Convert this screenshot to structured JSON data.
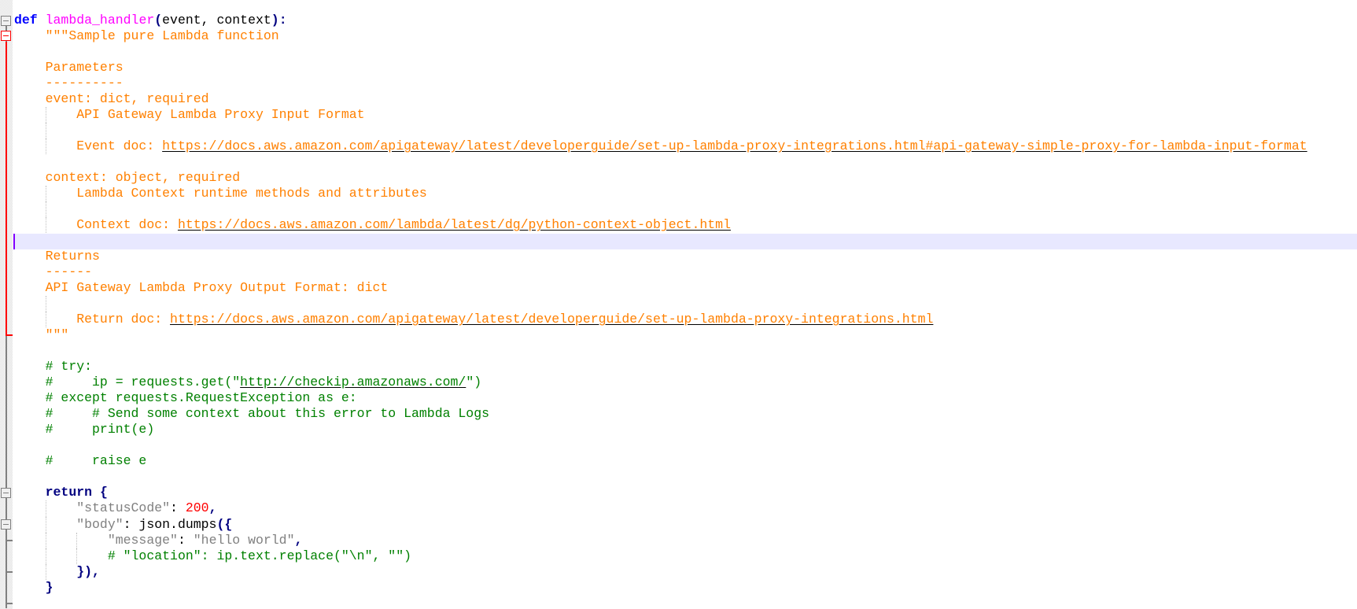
{
  "editor": {
    "language": "python",
    "current_line_index": 14,
    "colors": {
      "keyword": "#0000ff",
      "function_name": "#ff00ff",
      "docstring": "#ff8000",
      "comment": "#008000",
      "string": "#808080",
      "number": "#ff0000",
      "operator": "#000080",
      "current_line_bg": "#e8e8ff",
      "fold_marker_active": "#ff0000",
      "fold_marker": "#808080"
    },
    "lines": [
      {
        "tokens": [
          {
            "t": "def",
            "c": "kw"
          },
          {
            "t": " ",
            "c": ""
          },
          {
            "t": "lambda_handler",
            "c": "fn"
          },
          {
            "t": "(",
            "c": "op"
          },
          {
            "t": "event, context",
            "c": ""
          },
          {
            "t": ")",
            "c": "op"
          },
          {
            "t": ":",
            "c": "op"
          }
        ]
      },
      {
        "indent": 4,
        "tokens": [
          {
            "t": "\"\"\"Sample pure Lambda function",
            "c": "doc"
          }
        ]
      },
      {
        "indent": 4,
        "tokens": []
      },
      {
        "indent": 4,
        "tokens": [
          {
            "t": "Parameters",
            "c": "doc"
          }
        ]
      },
      {
        "indent": 4,
        "tokens": [
          {
            "t": "----------",
            "c": "doc"
          }
        ]
      },
      {
        "indent": 4,
        "tokens": [
          {
            "t": "event: dict, required",
            "c": "doc"
          }
        ]
      },
      {
        "indent": 8,
        "tokens": [
          {
            "t": "API Gateway Lambda Proxy Input Format",
            "c": "doc"
          }
        ]
      },
      {
        "indent": 8,
        "tokens": []
      },
      {
        "indent": 8,
        "tokens": [
          {
            "t": "Event doc: ",
            "c": "doc"
          },
          {
            "t": "https://docs.aws.amazon.com/apigateway/latest/developerguide/set-up-lambda-proxy-integrations.html#api-gateway-simple-proxy-for-lambda-input-format",
            "c": "doc link"
          }
        ]
      },
      {
        "indent": 4,
        "tokens": []
      },
      {
        "indent": 4,
        "tokens": [
          {
            "t": "context: object, required",
            "c": "doc"
          }
        ]
      },
      {
        "indent": 8,
        "tokens": [
          {
            "t": "Lambda Context runtime methods and attributes",
            "c": "doc"
          }
        ]
      },
      {
        "indent": 8,
        "tokens": []
      },
      {
        "indent": 8,
        "tokens": [
          {
            "t": "Context doc: ",
            "c": "doc"
          },
          {
            "t": "https://docs.aws.amazon.com/lambda/latest/dg/python-context-object.html",
            "c": "doc link"
          }
        ]
      },
      {
        "indent": 0,
        "tokens": []
      },
      {
        "indent": 4,
        "tokens": [
          {
            "t": "Returns",
            "c": "doc"
          }
        ]
      },
      {
        "indent": 4,
        "tokens": [
          {
            "t": "------",
            "c": "doc"
          }
        ]
      },
      {
        "indent": 4,
        "tokens": [
          {
            "t": "API Gateway Lambda Proxy Output Format: dict",
            "c": "doc"
          }
        ]
      },
      {
        "indent": 8,
        "tokens": []
      },
      {
        "indent": 8,
        "tokens": [
          {
            "t": "Return doc: ",
            "c": "doc"
          },
          {
            "t": "https://docs.aws.amazon.com/apigateway/latest/developerguide/set-up-lambda-proxy-integrations.html",
            "c": "doc link"
          }
        ]
      },
      {
        "indent": 4,
        "tokens": [
          {
            "t": "\"\"\"",
            "c": "doc"
          }
        ]
      },
      {
        "indent": 0,
        "tokens": []
      },
      {
        "indent": 4,
        "tokens": [
          {
            "t": "# try:",
            "c": "cm"
          }
        ]
      },
      {
        "indent": 4,
        "tokens": [
          {
            "t": "#     ip = requests.get(\"",
            "c": "cm"
          },
          {
            "t": "http://checkip.amazonaws.com/",
            "c": "cm link"
          },
          {
            "t": "\")",
            "c": "cm"
          }
        ]
      },
      {
        "indent": 4,
        "tokens": [
          {
            "t": "# except requests.RequestException as e:",
            "c": "cm"
          }
        ]
      },
      {
        "indent": 4,
        "tokens": [
          {
            "t": "#     # Send some context about this error to Lambda Logs",
            "c": "cm"
          }
        ]
      },
      {
        "indent": 4,
        "tokens": [
          {
            "t": "#     print(e)",
            "c": "cm"
          }
        ]
      },
      {
        "indent": 0,
        "tokens": []
      },
      {
        "indent": 4,
        "tokens": [
          {
            "t": "#     raise e",
            "c": "cm"
          }
        ]
      },
      {
        "indent": 0,
        "tokens": []
      },
      {
        "indent": 4,
        "tokens": [
          {
            "t": "return",
            "c": "kwr"
          },
          {
            "t": " ",
            "c": ""
          },
          {
            "t": "{",
            "c": "op"
          }
        ]
      },
      {
        "indent": 8,
        "tokens": [
          {
            "t": "\"statusCode\"",
            "c": "str"
          },
          {
            "t": ": ",
            "c": ""
          },
          {
            "t": "200",
            "c": "num"
          },
          {
            "t": ",",
            "c": "op"
          }
        ]
      },
      {
        "indent": 8,
        "tokens": [
          {
            "t": "\"body\"",
            "c": "str"
          },
          {
            "t": ": json.dumps",
            "c": ""
          },
          {
            "t": "({",
            "c": "op"
          }
        ]
      },
      {
        "indent": 12,
        "tokens": [
          {
            "t": "\"message\"",
            "c": "str"
          },
          {
            "t": ": ",
            "c": ""
          },
          {
            "t": "\"hello world\"",
            "c": "str"
          },
          {
            "t": ",",
            "c": "op"
          }
        ]
      },
      {
        "indent": 12,
        "tokens": [
          {
            "t": "# \"location\": ip.text.replace(\"\\n\", \"\")",
            "c": "cm"
          }
        ]
      },
      {
        "indent": 8,
        "tokens": [
          {
            "t": "}),",
            "c": "op"
          }
        ]
      },
      {
        "indent": 4,
        "tokens": [
          {
            "t": "}",
            "c": "op"
          }
        ]
      }
    ]
  }
}
